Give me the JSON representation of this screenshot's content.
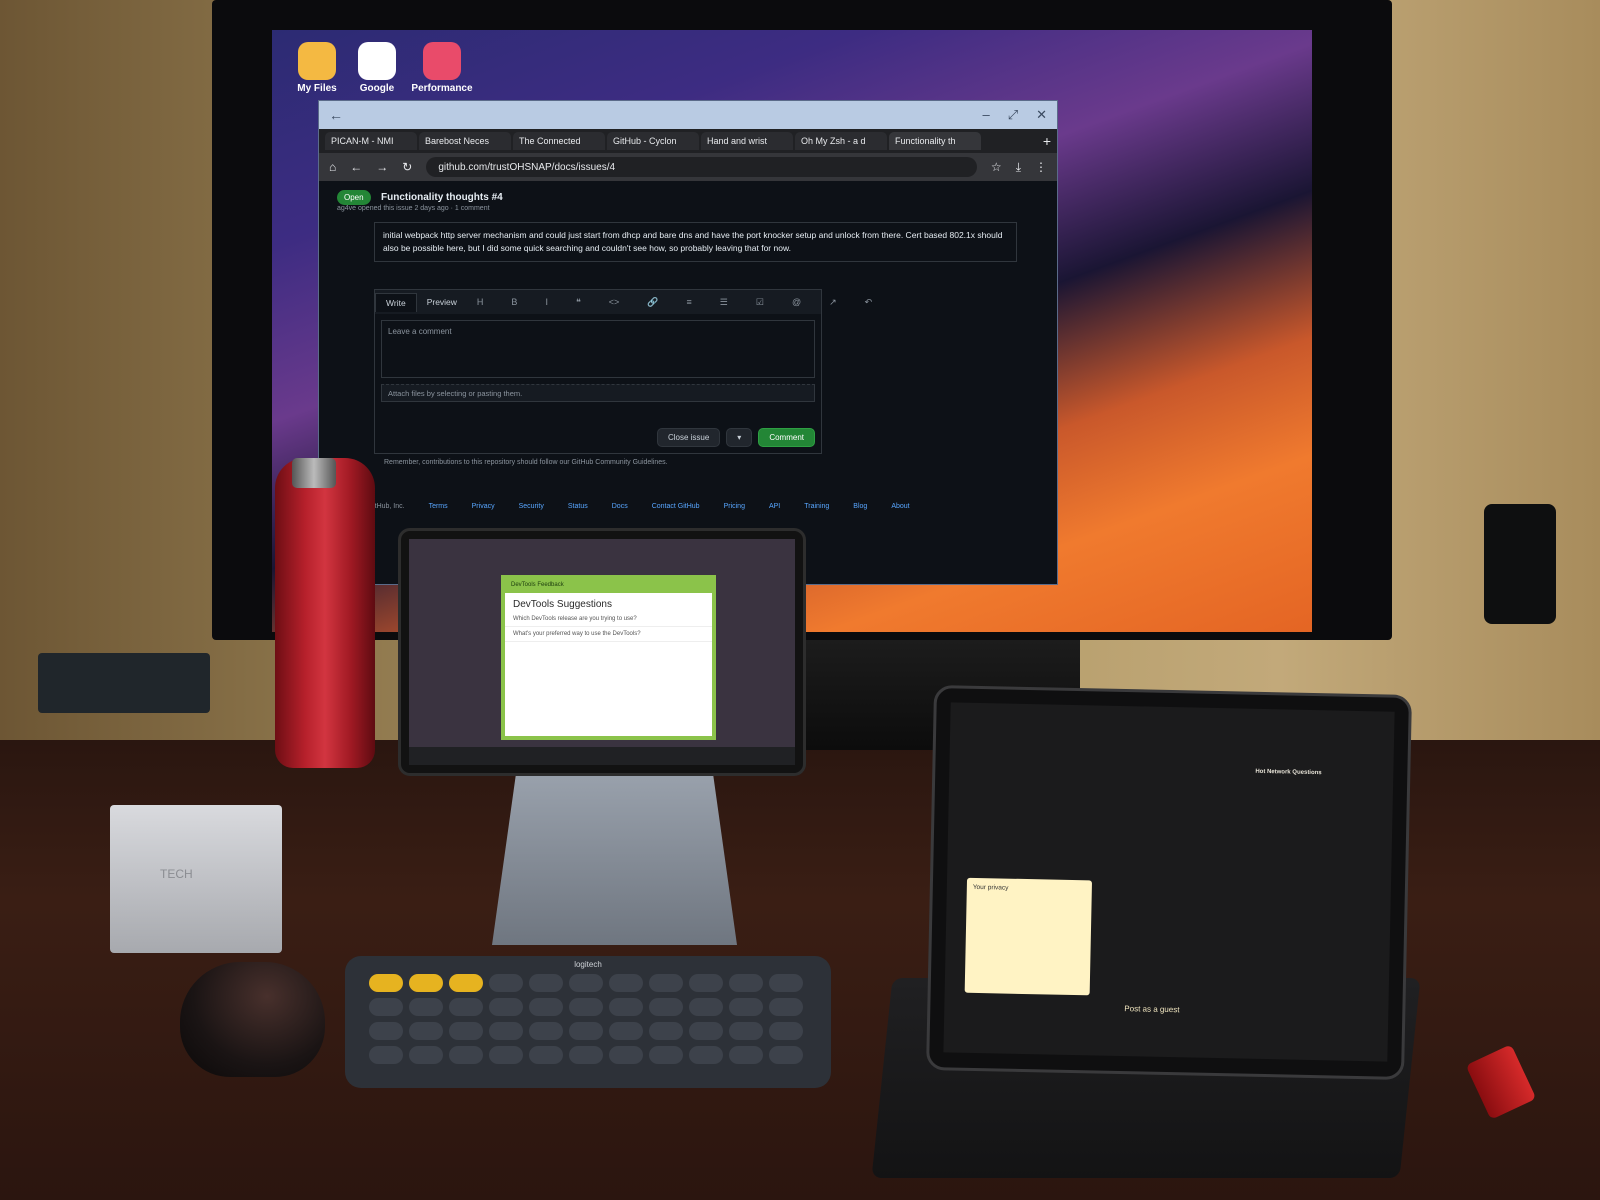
{
  "tv_desktop": {
    "launchers": [
      {
        "label": "My Files",
        "icon": "folder-icon",
        "color": "#f4b942"
      },
      {
        "label": "Google",
        "icon": "google-icon",
        "color": "#ffffff"
      },
      {
        "label": "Performance",
        "icon": "performance-icon",
        "color": "#e94b6a"
      }
    ]
  },
  "browser": {
    "tabs": [
      "PICAN-M - NMI",
      "Barebost Neces",
      "The Connected",
      "GitHub - Cyclon",
      "Hand and wrist",
      "Oh My Zsh - a d",
      "Functionality th"
    ],
    "new_tab": "+",
    "url": "github.com/trustOHSNAP/docs/issues/4",
    "issue": {
      "title": "Functionality thoughts #4",
      "status": "Open",
      "meta": "ag4ve opened this issue 2 days ago · 1 comment",
      "comment_text": "initial webpack http server mechanism and could just start from dhcp and bare dns and have the port knocker setup and unlock from there. Cert based 802.1x should also be possible here, but I did some quick searching and couldn't see how, so probably leaving that for now."
    },
    "editor": {
      "tab_write": "Write",
      "tab_preview": "Preview",
      "placeholder": "Leave a comment",
      "attach_hint": "Attach files by selecting or pasting them.",
      "close_issue": "Close issue",
      "comment": "Comment",
      "guidelines": "Remember, contributions to this repository should follow our GitHub Community Guidelines."
    },
    "footer": {
      "copyright": "© 2022 GitHub, Inc.",
      "links": [
        "Terms",
        "Privacy",
        "Security",
        "Status",
        "Docs",
        "Contact GitHub",
        "Pricing",
        "API",
        "Training",
        "Blog",
        "About"
      ]
    }
  },
  "tablet": {
    "window_title": "DevTools Feedback",
    "heading": "DevTools Suggestions",
    "questions": [
      "Which DevTools release are you trying to use?",
      "What's your preferred way to use the DevTools?"
    ]
  },
  "keyboard": {
    "brand": "logitech"
  },
  "phone_stand": {
    "brand": "TECH"
  },
  "ipad": {
    "sidebar_heading": "Hot Network Questions",
    "cookie_title": "Your privacy",
    "post_button": "Post as a guest"
  },
  "colors": {
    "github_green": "#238636",
    "devtools_green": "#8bc34a",
    "bottle_red": "#c02530"
  }
}
